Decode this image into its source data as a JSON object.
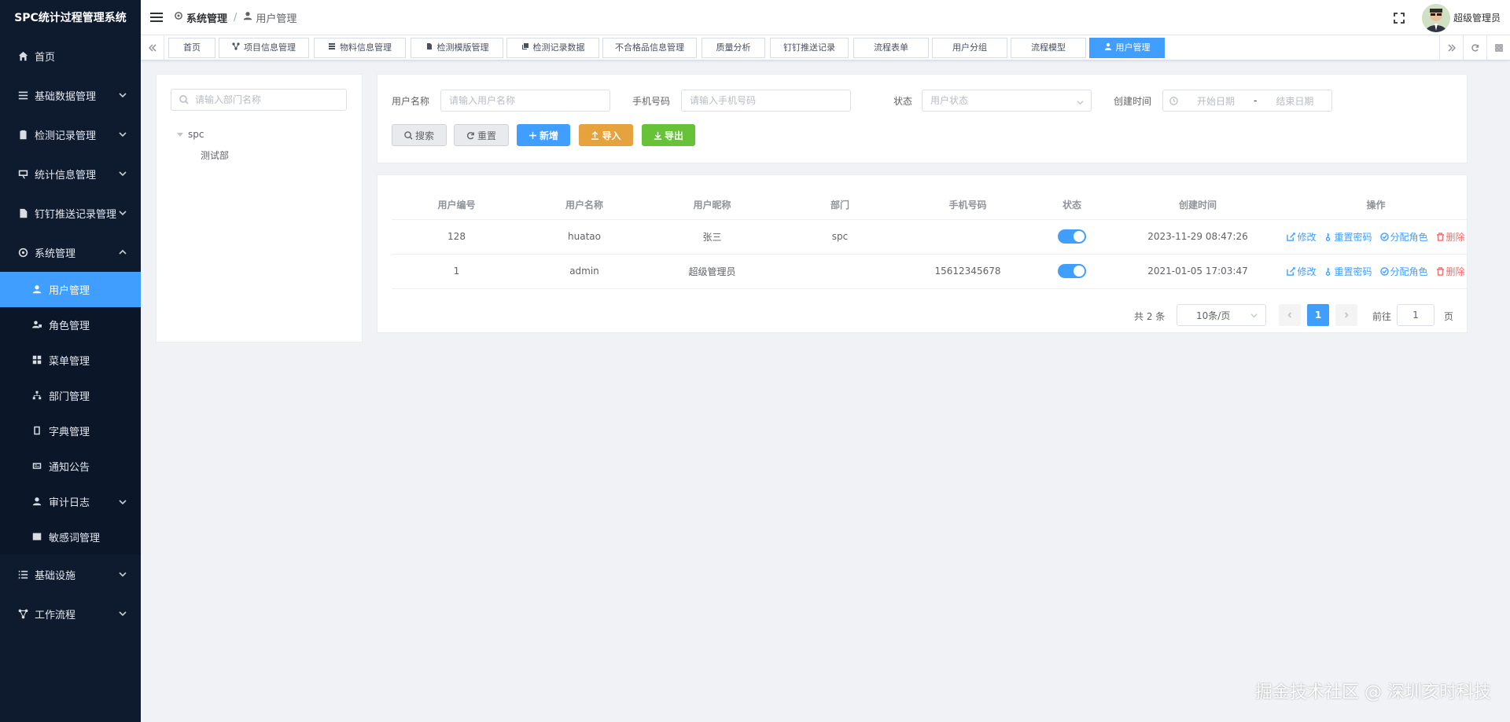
{
  "app": {
    "title": "SPC统计过程管理系统"
  },
  "sidebar": {
    "items": [
      {
        "label": "首页",
        "icon": "home-icon"
      },
      {
        "label": "基础数据管理",
        "icon": "list-icon"
      },
      {
        "label": "检测记录管理",
        "icon": "clipboard-icon"
      },
      {
        "label": "统计信息管理",
        "icon": "chart-icon"
      },
      {
        "label": "钉钉推送记录管理",
        "icon": "doc-icon"
      },
      {
        "label": "系统管理",
        "icon": "gear-icon"
      }
    ],
    "sub_items": [
      {
        "label": "用户管理",
        "icon": "user-icon",
        "active": true
      },
      {
        "label": "角色管理",
        "icon": "role-icon"
      },
      {
        "label": "菜单管理",
        "icon": "grid-icon"
      },
      {
        "label": "部门管理",
        "icon": "tree-icon"
      },
      {
        "label": "字典管理",
        "icon": "book-icon"
      },
      {
        "label": "通知公告",
        "icon": "message-icon"
      },
      {
        "label": "审计日志",
        "icon": "log-icon"
      },
      {
        "label": "敏感词管理",
        "icon": "image-icon"
      }
    ],
    "bottom_items": [
      {
        "label": "基础设施",
        "icon": "list-icon"
      },
      {
        "label": "工作流程",
        "icon": "flow-icon"
      }
    ]
  },
  "header": {
    "breadcrumb": [
      "系统管理",
      "用户管理"
    ],
    "username": "超级管理员"
  },
  "tags": [
    {
      "label": "首页"
    },
    {
      "label": "项目信息管理"
    },
    {
      "label": "物料信息管理"
    },
    {
      "label": "检测模版管理"
    },
    {
      "label": "检测记录数据"
    },
    {
      "label": "不合格品信息管理"
    },
    {
      "label": "质量分析"
    },
    {
      "label": "钉钉推送记录"
    },
    {
      "label": "流程表单"
    },
    {
      "label": "用户分组"
    },
    {
      "label": "流程模型"
    },
    {
      "label": "用户管理",
      "active": true
    }
  ],
  "tree": {
    "search_placeholder": "请输入部门名称",
    "root": "spc",
    "child": "测试部"
  },
  "filters": {
    "username_label": "用户名称",
    "username_placeholder": "请输入用户名称",
    "phone_label": "手机号码",
    "phone_placeholder": "请输入手机号码",
    "status_label": "状态",
    "status_placeholder": "用户状态",
    "created_label": "创建时间",
    "start_placeholder": "开始日期",
    "range_sep": "-",
    "end_placeholder": "结束日期"
  },
  "buttons": {
    "search": "搜索",
    "reset": "重置",
    "add": "新增",
    "import": "导入",
    "export": "导出"
  },
  "table": {
    "columns": [
      "用户编号",
      "用户名称",
      "用户昵称",
      "部门",
      "手机号码",
      "状态",
      "创建时间",
      "操作"
    ],
    "rows": [
      {
        "id": "128",
        "username": "huatao",
        "nickname": "张三",
        "dept": "spc",
        "phone": "",
        "enabled": true,
        "created": "2023-11-29 08:47:26"
      },
      {
        "id": "1",
        "username": "admin",
        "nickname": "超级管理员",
        "dept": "",
        "phone": "15612345678",
        "enabled": true,
        "created": "2021-01-05 17:03:47"
      }
    ],
    "ops": {
      "edit": "修改",
      "reset_pwd": "重置密码",
      "assign_role": "分配角色",
      "delete": "删除"
    }
  },
  "pagination": {
    "total": "共 2 条",
    "page_size": "10条/页",
    "current": "1",
    "goto_label": "前往",
    "goto_value": "1",
    "page_suffix": "页"
  },
  "watermark": "掘金技术社区 @ 深圳亥时科技",
  "colors": {
    "sidebar_bg": "#0e1a2e",
    "primary": "#409eff",
    "warning": "#e6a23c",
    "success": "#67c23a",
    "danger": "#f56c6c"
  }
}
